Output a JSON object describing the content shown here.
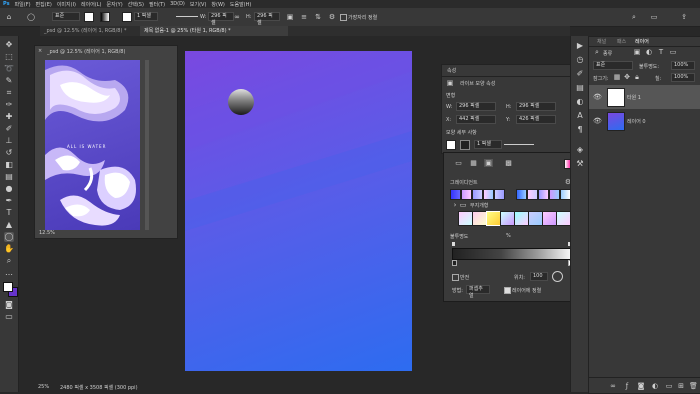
{
  "menubar": {
    "items": [
      "Ps",
      "파일(F)",
      "편집(E)",
      "이미지(I)",
      "레이어(L)",
      "문자(Y)",
      "선택(S)",
      "필터(T)",
      "3D(D)",
      "보기(V)",
      "창(W)",
      "도움말(H)"
    ]
  },
  "options": {
    "mode_label": "모드",
    "mode_value": "표준",
    "opacity_label": "불투명도",
    "width_label": "W:",
    "width_value": "296 픽셀",
    "height_label": "H:",
    "height_value": "296 픽셀",
    "align_label": "가장자리 정렬"
  },
  "tabs": [
    {
      "label": "_psd @ 12.5% (레이어 1, RGB/8) *",
      "active": false
    },
    {
      "label": "제목 없음-1 @ 25% (타원 1, RGB/8) *",
      "active": true
    }
  ],
  "navigator_window": {
    "title": "_psd @ 12.5% (레이어 1, RGB/8)",
    "zoom": "12.5%",
    "art_text": "ALL IS WATER"
  },
  "statusbar": {
    "zoom": "25%",
    "doc_size": "2480 픽셀 x 3508 픽셀 (300 ppi)"
  },
  "properties": {
    "tab": "속성",
    "title": "라이브 모양 속성",
    "section_transform": "변형",
    "w_label": "W:",
    "w_value": "296 픽셀",
    "h_label": "H:",
    "h_value": "296 픽셀",
    "x_label": "X:",
    "x_value": "442 픽셀",
    "y_label": "Y:",
    "y_value": "426 픽셀",
    "section_appearance": "모양 세부 사항",
    "stroke_value": "1 픽셀"
  },
  "gradient_popup": {
    "section_label": "그레이디언트",
    "folder_label": "무지개형",
    "opacity_stop_label": "불투명도",
    "smooth_label": "매끄러움",
    "location_label": "위치:",
    "location_value": "100",
    "reverse_label": "반전",
    "dither_label": "디더",
    "method_label": "방법:",
    "method_value": "퍼셉추얼",
    "use_label": "레이어에 정렬",
    "percent": "%"
  },
  "layers_panel": {
    "tabs": [
      "채널",
      "패스",
      "레이어"
    ],
    "kind_label": "종류",
    "blend_mode": "표준",
    "opacity_label": "불투명도:",
    "opacity_value": "100%",
    "lock_label": "잠그기:",
    "fill_label": "칠:",
    "fill_value": "100%",
    "layers": [
      {
        "name": "타원 1",
        "active": true
      },
      {
        "name": "레이어 0",
        "active": false
      }
    ]
  },
  "colors": {
    "canvas_top": "#7a48e0",
    "canvas_bottom": "#2d6cf0",
    "foreground": "#ffffff",
    "background": "#6633cc"
  }
}
